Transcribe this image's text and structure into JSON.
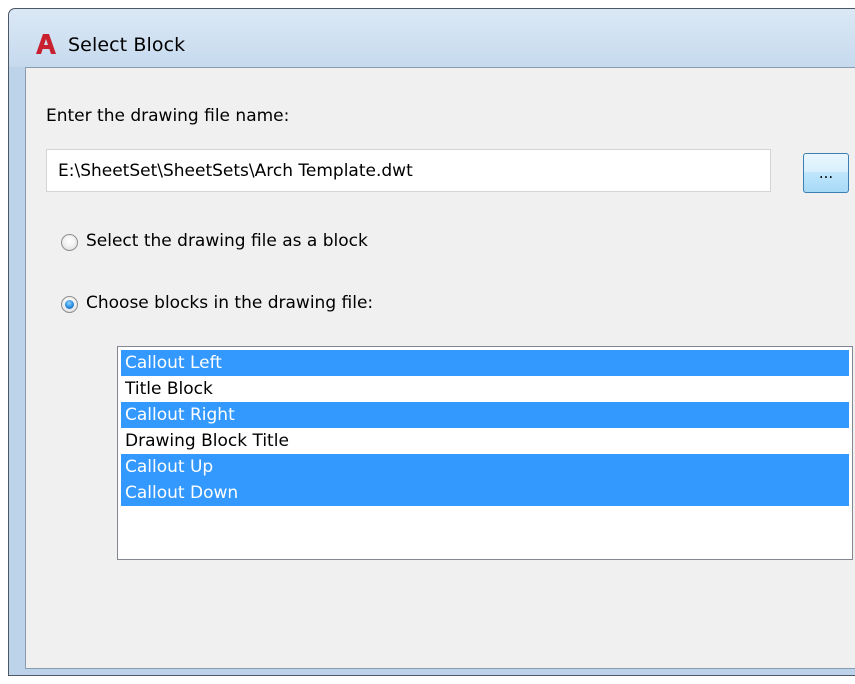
{
  "window": {
    "title": "Select Block",
    "icon": "autocad-a-icon",
    "accent_color": "#c8202f"
  },
  "form": {
    "file_label": "Enter the drawing file name:",
    "file_value": "E:\\SheetSet\\SheetSets\\Arch Template.dwt",
    "browse_label": "...",
    "options": [
      {
        "label": "Select the drawing file as a block",
        "checked": false
      },
      {
        "label": "Choose blocks in the drawing file:",
        "checked": true
      }
    ]
  },
  "blocks": [
    {
      "label": "Callout Left",
      "selected": true
    },
    {
      "label": "Title Block",
      "selected": false
    },
    {
      "label": "Callout Right",
      "selected": true
    },
    {
      "label": "Drawing Block Title",
      "selected": false
    },
    {
      "label": "Callout Up",
      "selected": true
    },
    {
      "label": "Callout Down",
      "selected": true
    }
  ],
  "colors": {
    "selection": "#3399ff",
    "titlebar": "#c6daee"
  }
}
